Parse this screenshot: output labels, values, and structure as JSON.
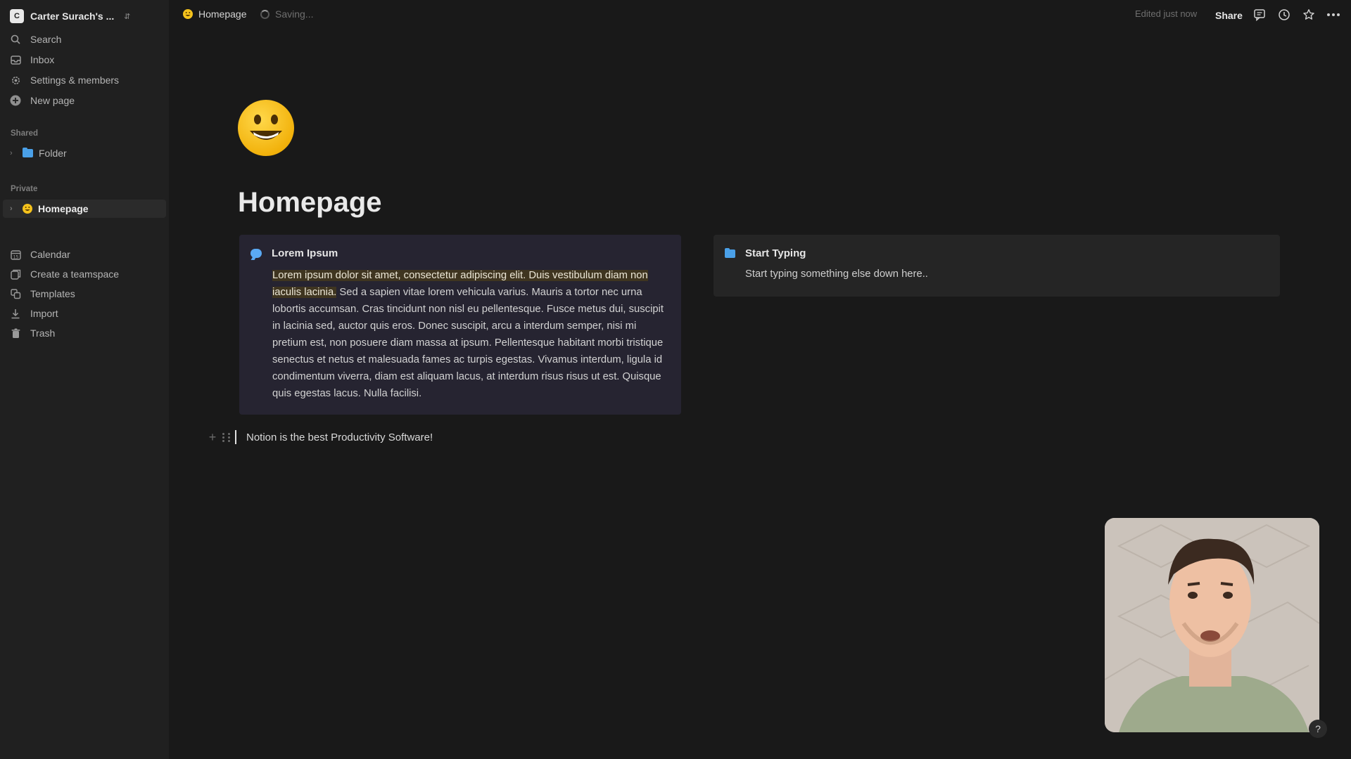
{
  "workspace": {
    "name": "Carter Surach's ...",
    "initial": "C"
  },
  "sidebar": {
    "top_items": [
      {
        "label": "Search",
        "icon": "search-icon"
      },
      {
        "label": "Inbox",
        "icon": "inbox-icon"
      },
      {
        "label": "Settings & members",
        "icon": "gear-icon"
      },
      {
        "label": "New page",
        "icon": "plus-circle-icon"
      }
    ],
    "shared_label": "Shared",
    "shared_items": [
      {
        "label": "Folder",
        "icon": "folder-icon"
      }
    ],
    "private_label": "Private",
    "private_items": [
      {
        "label": "Homepage",
        "icon": "smiley-icon",
        "active": true
      }
    ],
    "bottom_items": [
      {
        "label": "Calendar",
        "icon": "calendar-icon"
      },
      {
        "label": "Create a teamspace",
        "icon": "teamspace-icon"
      },
      {
        "label": "Templates",
        "icon": "templates-icon"
      },
      {
        "label": "Import",
        "icon": "import-icon"
      },
      {
        "label": "Trash",
        "icon": "trash-icon"
      }
    ]
  },
  "topbar": {
    "breadcrumb": "Homepage",
    "status": "Saving...",
    "edited": "Edited just now",
    "share_label": "Share"
  },
  "page": {
    "title": "Homepage",
    "callout": {
      "title": "Lorem Ipsum",
      "highlighted_text": "Lorem ipsum dolor sit amet, consectetur adipiscing elit. Duis vestibulum diam non iaculis lacinia.",
      "text": " Sed a sapien vitae lorem vehicula varius. Mauris a tortor nec urna lobortis accumsan. Cras tincidunt non nisl eu pellentesque. Fusce metus dui, suscipit in lacinia sed, auctor quis eros. Donec suscipit, arcu a interdum semper, nisi mi pretium est, non posuere diam massa at ipsum. Pellentesque habitant morbi tristique senectus et netus et malesuada fames ac turpis egestas. Vivamus interdum, ligula id condimentum viverra, diam est aliquam lacus, at interdum risus risus ut est. Quisque quis egestas lacus. Nulla facilisi."
    },
    "card": {
      "title": "Start Typing",
      "text": "Start typing something else down here.."
    },
    "block_text": "Notion is the best Productivity Software!"
  },
  "help_label": "?",
  "colors": {
    "background": "#191919",
    "sidebar": "#202020",
    "callout_bg": "#262431",
    "highlight": "#3f3520",
    "accent_blue": "#5aa9f3"
  }
}
